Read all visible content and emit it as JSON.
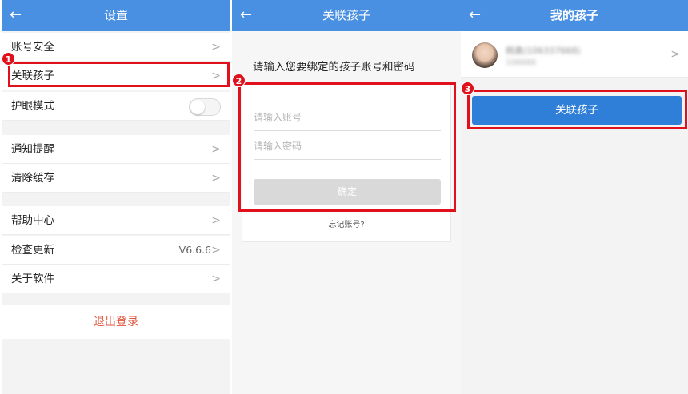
{
  "settings": {
    "title": "设置",
    "back_icon": "←",
    "items": [
      {
        "label": "账号安全"
      },
      {
        "label": "关联孩子"
      },
      {
        "label": "护眼模式"
      },
      {
        "label": "通知提醒"
      },
      {
        "label": "清除缓存"
      },
      {
        "label": "帮助中心"
      },
      {
        "label": "检查更新",
        "value": "V6.6.6"
      },
      {
        "label": "关于软件"
      }
    ],
    "logout": "退出登录",
    "eye_mode_on": false
  },
  "link_child": {
    "title": "关联孩子",
    "back_icon": "←",
    "prompt": "请输入您要绑定的孩子账号和密码",
    "account_placeholder": "请输入账号",
    "password_placeholder": "请输入密码",
    "confirm": "确定",
    "forgot": "忘记账号?"
  },
  "my_child": {
    "title": "我的孩子",
    "back_icon": "←",
    "child_name": "杨勇(106337668)",
    "child_sub": "106666",
    "link_button": "关联孩子"
  },
  "chevron": ">",
  "steps": [
    "1",
    "2",
    "3"
  ],
  "colors": {
    "header": "#4a90e2",
    "highlight": "#e0101d",
    "logout": "#e2553d",
    "primary_button": "#2f7fd8"
  }
}
